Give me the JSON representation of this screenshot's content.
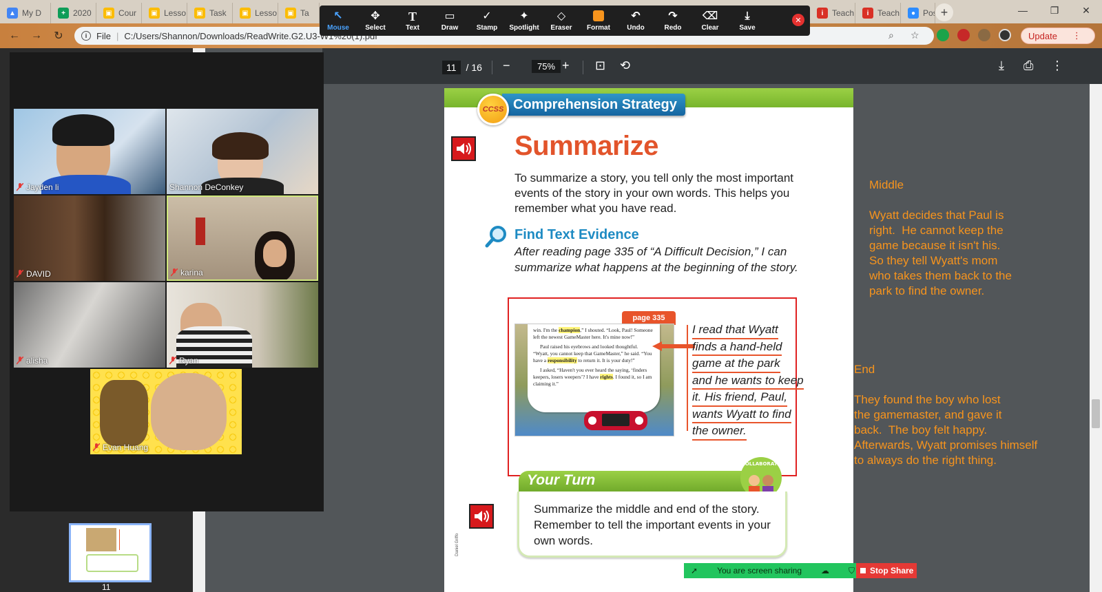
{
  "browser": {
    "tabs": [
      {
        "label": "My D",
        "color": "#4285f4",
        "glyph": "▲"
      },
      {
        "label": "2020",
        "color": "#0f9d58",
        "glyph": "+"
      },
      {
        "label": "Cour",
        "color": "#fbbc04",
        "glyph": "▣"
      },
      {
        "label": "Lesso",
        "color": "#fbbc04",
        "glyph": "▣"
      },
      {
        "label": "Task",
        "color": "#fbbc04",
        "glyph": "▣"
      },
      {
        "label": "Lesso",
        "color": "#fbbc04",
        "glyph": "▣"
      },
      {
        "label": "Ta",
        "color": "#fbbc04",
        "glyph": "▣"
      }
    ],
    "right_tabs": [
      {
        "label": "Teach",
        "color": "#d93025",
        "glyph": "i"
      },
      {
        "label": "Teach",
        "color": "#d93025",
        "glyph": "i"
      },
      {
        "label": "Post",
        "color": "#2d8cff",
        "glyph": "●"
      }
    ],
    "address": {
      "scheme": "File",
      "url": "C:/Users/Shannon/Downloads/ReadWrite.G2.U3-W1%20(1).pdf"
    },
    "update_label": "Update"
  },
  "annotation_toolbar": {
    "tools": [
      {
        "label": "Mouse",
        "glyph": "↖",
        "active": true
      },
      {
        "label": "Select",
        "glyph": "✥"
      },
      {
        "label": "Text",
        "glyph": "T"
      },
      {
        "label": "Draw",
        "glyph": "▭"
      },
      {
        "label": "Stamp",
        "glyph": "✓"
      },
      {
        "label": "Spotlight",
        "glyph": "✦"
      },
      {
        "label": "Eraser",
        "glyph": "◇"
      },
      {
        "label": "Format",
        "glyph": "■"
      },
      {
        "label": "Undo",
        "glyph": "↶"
      },
      {
        "label": "Redo",
        "glyph": "↷"
      },
      {
        "label": "Clear",
        "glyph": "🗑"
      },
      {
        "label": "Save",
        "glyph": "⤓"
      }
    ],
    "format_color": "#f7941d"
  },
  "pdf": {
    "current_page": "11",
    "total_pages": "/ 16",
    "zoom": "75%",
    "thumbnail_label": "11"
  },
  "page": {
    "badge": "CCSS",
    "strategy": "Comprehension Strategy",
    "title": "Summarize",
    "intro": "To summarize a story, you tell only the most important events of the story in your own words. This helps you remember what you have read.",
    "find_heading": "Find Text Evidence",
    "find_body": "After reading page 335 of “A Difficult Decision,” I can summarize what happens at the beginning of the story.",
    "page_tag": "page 335",
    "excerpt": {
      "p1a": "win. I'm the ",
      "p1b": "champion",
      "p1c": ",” I shouted. “Look, Paul! Someone left the newest GameMaster here. It's mine now!”",
      "p2a": "Paul raised his eyebrows and looked thoughtful. “Wyatt, you cannot keep that GameMaster,” he said. “You have a ",
      "p2b": "responsibility",
      "p2c": " to return it. It is your duty!”",
      "p3a": "I asked, “Haven't you ever heard the saying, ‘finders keepers, losers weepers’? I have ",
      "p3b": "rights",
      "p3c": ". I found it, so I am claiming it.”"
    },
    "answer_lines": [
      "I read that Wyatt",
      "finds a hand-held",
      "game at the park",
      "and he wants to keep",
      "it. His friend, Paul,",
      "wants Wyatt to find",
      "the owner."
    ],
    "your_turn": "Your Turn",
    "collaborate": "COLLABORATE",
    "your_turn_body": "Summarize the middle and end of the story. Remember to tell the important events in your own words.",
    "credit": "Daniel Griffo"
  },
  "notes": {
    "middle": "Middle\n\nWyatt decides that Paul is\nright.  He cannot keep the\ngame because it isn't his.\nSo they tell Wyatt's mom\nwho takes them back to the\npark to find the owner.",
    "end": "End\n\nThey found the boy who lost\nthe gamemaster, and gave it\nback.  The boy felt happy.\nAfterwards, Wyatt promises himself\nto always do the right thing."
  },
  "participants": [
    {
      "name": "Jayden li"
    },
    {
      "name": "Shannon DeConkey"
    },
    {
      "name": "DAVID"
    },
    {
      "name": "karina"
    },
    {
      "name": "alisha"
    },
    {
      "name": "Ryan"
    },
    {
      "name": "Evan Huang"
    }
  ],
  "share": {
    "status": "You are screen sharing",
    "stop": "Stop Share"
  }
}
